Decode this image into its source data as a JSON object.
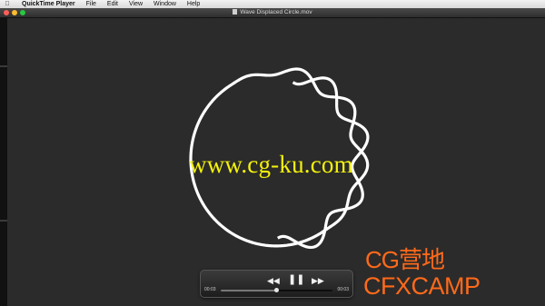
{
  "menubar": {
    "apple_icon": "apple-icon",
    "app_name": "QuickTime Player",
    "items": [
      "File",
      "Edit",
      "View",
      "Window",
      "Help"
    ]
  },
  "window": {
    "title": "Wave Displaced Circle.mov",
    "controls": [
      "close",
      "minimize",
      "zoom"
    ]
  },
  "video": {
    "watermark": "www.cg-ku.com",
    "watermark_color": "#f4f20c",
    "background_color": "#2b2b2b"
  },
  "controller": {
    "elapsed": "00:03",
    "remaining": "00:03",
    "rewind_icon": "rewind-icon",
    "pause_icon": "pause-icon",
    "fast_forward_icon": "fast-forward-icon",
    "progress_fraction": 0.5
  },
  "logo": {
    "line1": "CG营地",
    "line2": "CFXCAMP",
    "color": "#ff6a1a"
  }
}
